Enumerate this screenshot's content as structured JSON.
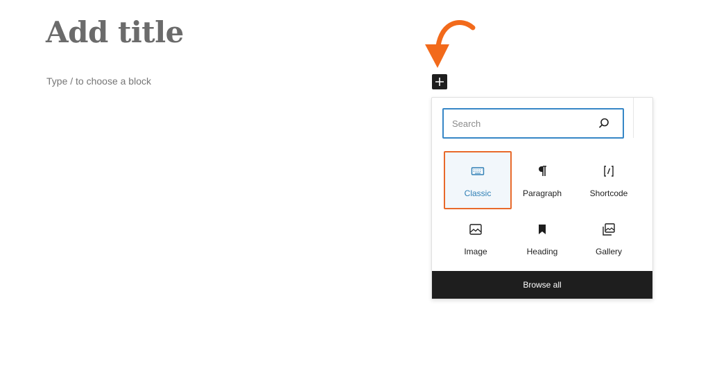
{
  "editor": {
    "title_placeholder": "Add title",
    "block_placeholder": "Type / to choose a block"
  },
  "inserter": {
    "toggle_icon": "plus-icon",
    "search": {
      "placeholder": "Search",
      "icon": "search-icon"
    },
    "blocks": [
      {
        "label": "Classic",
        "icon": "keyboard-icon",
        "selected": true
      },
      {
        "label": "Paragraph",
        "icon": "pilcrow-icon"
      },
      {
        "label": "Shortcode",
        "icon": "shortcode-icon"
      },
      {
        "label": "Image",
        "icon": "image-icon"
      },
      {
        "label": "Heading",
        "icon": "bookmark-icon"
      },
      {
        "label": "Gallery",
        "icon": "gallery-icon"
      }
    ],
    "browse_all_label": "Browse all"
  },
  "colors": {
    "annotation_arrow": "#f26a1b",
    "highlight_border": "#e8692a",
    "search_focus": "#3586c6",
    "dark": "#1e1e1e"
  }
}
